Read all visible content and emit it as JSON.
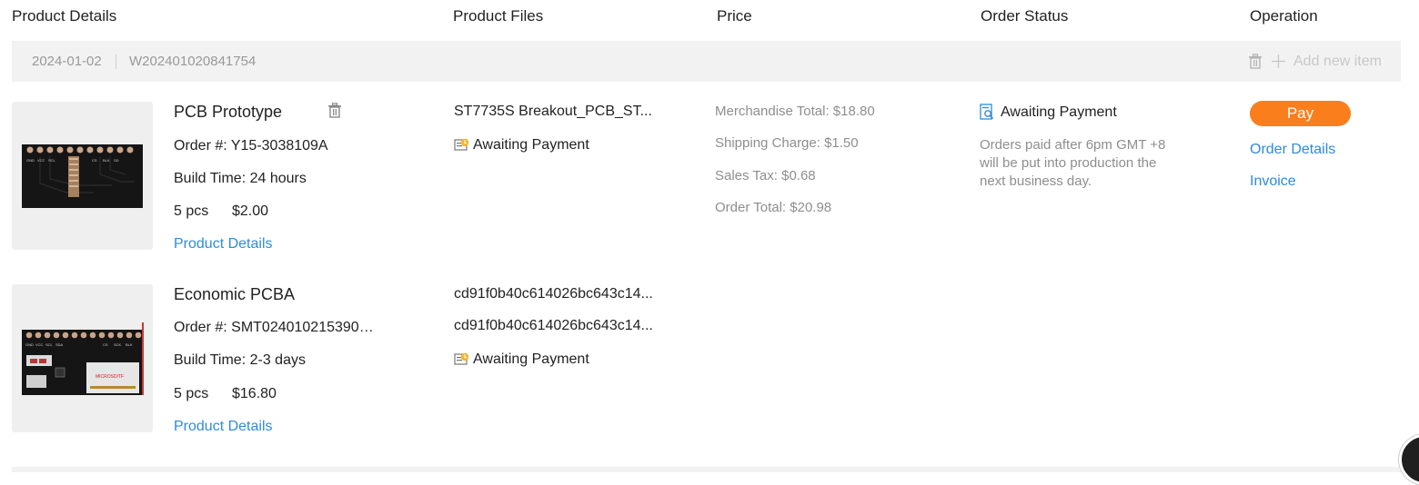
{
  "table_header": {
    "product_details": "Product Details",
    "product_files": "Product Files",
    "price": "Price",
    "order_status": "Order Status",
    "operation": "Operation"
  },
  "group": {
    "date": "2024-01-02",
    "order_no": "W202401020841754",
    "add_new_item": "Add new item"
  },
  "items": [
    {
      "title": "PCB Prototype",
      "order_label": "Order #:",
      "order_value": "Y15-3038109A",
      "build_label": "Build Time:",
      "build_value": "24 hours",
      "qty": "5 pcs",
      "price": "$2.00",
      "details_link": "Product Details",
      "files": [
        "ST7735S Breakout_PCB_ST..."
      ],
      "file_status": "Awaiting Payment"
    },
    {
      "title": "Economic PCBA",
      "order_label": "Order #:",
      "order_value": "SMT0240102153903...",
      "build_label": "Build Time:",
      "build_value": "2-3 days",
      "qty": "5 pcs",
      "price": "$16.80",
      "details_link": "Product Details",
      "files": [
        "cd91f0b40c614026bc643c14...",
        "cd91f0b40c614026bc643c14..."
      ],
      "file_status": "Awaiting Payment",
      "board_marking": "MICROSD/TF"
    }
  ],
  "price_summary": {
    "merchandise": "Merchandise Total: $18.80",
    "shipping": "Shipping Charge: $1.50",
    "tax": "Sales Tax: $0.68",
    "total": "Order Total: $20.98"
  },
  "status": {
    "label": "Awaiting Payment",
    "note_line1": "Orders paid after 6pm GMT +8",
    "note_line2": "will be put into production the",
    "note_line3": "next business day."
  },
  "operation": {
    "pay": "Pay",
    "order_details": "Order Details",
    "invoice": "Invoice"
  },
  "icons": {
    "trash": "trash-icon",
    "plus": "plus-icon",
    "file_status": "document-status-icon",
    "status_search": "search-document-icon"
  },
  "colors": {
    "accent_orange": "#fb7e1c",
    "link_blue": "#2e8bdc",
    "bar_gray": "#f2f2f2"
  }
}
